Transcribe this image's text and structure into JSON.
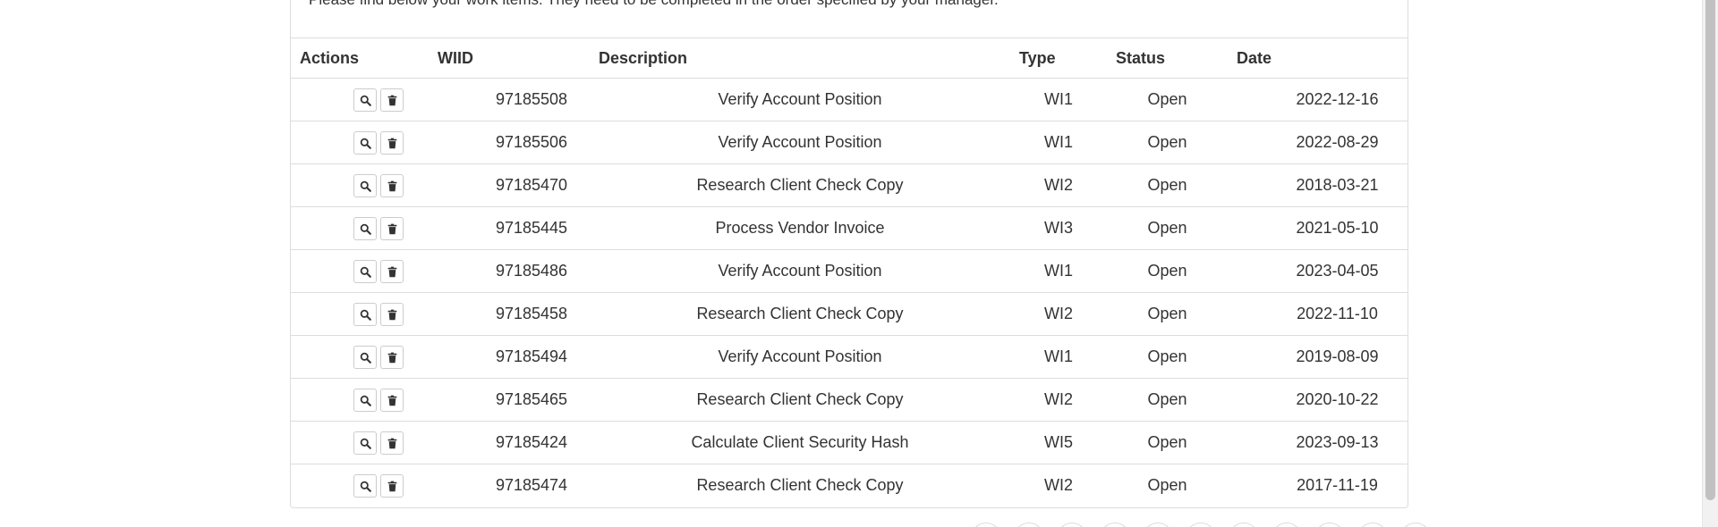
{
  "intro_text": "Please find below your work items. They need to be completed in the order specified by your manager.",
  "table": {
    "headers": [
      "Actions",
      "WIID",
      "Description",
      "Type",
      "Status",
      "Date"
    ],
    "rows": [
      {
        "wiid": "97185508",
        "description": "Verify Account Position",
        "type": "WI1",
        "status": "Open",
        "date": "2022-12-16"
      },
      {
        "wiid": "97185506",
        "description": "Verify Account Position",
        "type": "WI1",
        "status": "Open",
        "date": "2022-08-29"
      },
      {
        "wiid": "97185470",
        "description": "Research Client Check Copy",
        "type": "WI2",
        "status": "Open",
        "date": "2018-03-21"
      },
      {
        "wiid": "97185445",
        "description": "Process Vendor Invoice",
        "type": "WI3",
        "status": "Open",
        "date": "2021-05-10"
      },
      {
        "wiid": "97185486",
        "description": "Verify Account Position",
        "type": "WI1",
        "status": "Open",
        "date": "2023-04-05"
      },
      {
        "wiid": "97185458",
        "description": "Research Client Check Copy",
        "type": "WI2",
        "status": "Open",
        "date": "2022-11-10"
      },
      {
        "wiid": "97185494",
        "description": "Verify Account Position",
        "type": "WI1",
        "status": "Open",
        "date": "2019-08-09"
      },
      {
        "wiid": "97185465",
        "description": "Research Client Check Copy",
        "type": "WI2",
        "status": "Open",
        "date": "2020-10-22"
      },
      {
        "wiid": "97185424",
        "description": "Calculate Client Security Hash",
        "type": "WI5",
        "status": "Open",
        "date": "2023-09-13"
      },
      {
        "wiid": "97185474",
        "description": "Research Client Check Copy",
        "type": "WI2",
        "status": "Open",
        "date": "2017-11-19"
      }
    ],
    "row_actions": [
      "search-icon",
      "trash-icon"
    ]
  },
  "colors": {
    "text": "#333333",
    "border": "#dddddd",
    "button_border": "#cccccc",
    "scrollbar_thumb": "#c1c1c1"
  }
}
